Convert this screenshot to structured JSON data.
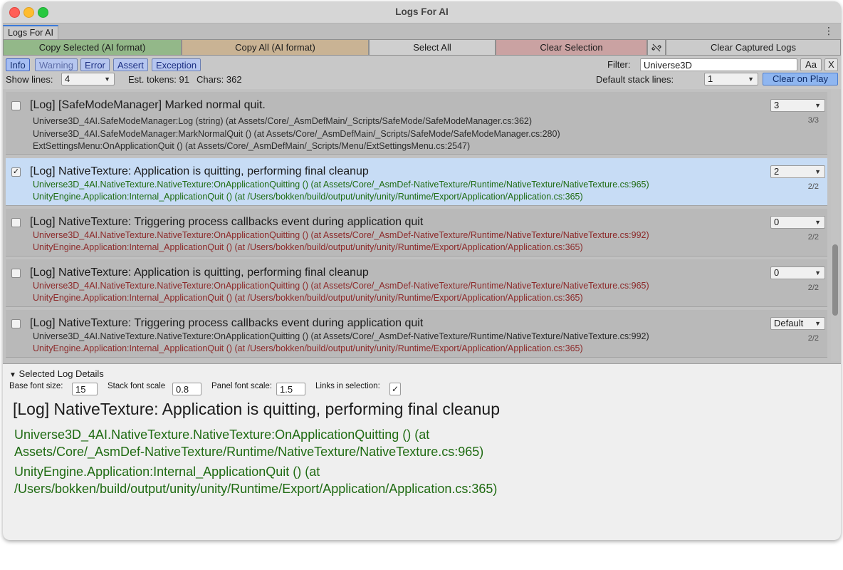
{
  "window": {
    "title": "Logs For AI"
  },
  "tabs": [
    {
      "label": "Logs For AI"
    }
  ],
  "toolbar": {
    "copy_selected": "Copy Selected (AI format)",
    "copy_all": "Copy All (AI format)",
    "select_all": "Select All",
    "clear_selection": "Clear Selection",
    "clear_captured": "Clear Captured Logs",
    "link_icon": "link-off-icon",
    "colors": {
      "copy_selected": "#93b889",
      "copy_all": "#c9b394",
      "select_all": "#cfcfcf",
      "clear_selection": "#caa2a2",
      "clear_captured": "#cbcbcb"
    }
  },
  "levels": [
    "Info",
    "Warning",
    "Error",
    "Assert",
    "Exception"
  ],
  "filter": {
    "label": "Filter:",
    "value": "Universe3D",
    "case_label": "Aa",
    "clear_label": "X"
  },
  "options": {
    "show_lines_label": "Show lines:",
    "show_lines_value": "4",
    "est_tokens": "Est. tokens: 91",
    "chars": "Chars: 362",
    "default_stack_label": "Default stack lines:",
    "default_stack_value": "1",
    "clear_on_play": "Clear on Play"
  },
  "entries": [
    {
      "checked": "",
      "message": "[Log] [SafeModeManager] Marked normal quit.",
      "lines_value": "3",
      "count": "3/3",
      "stack": [
        "Universe3D_4AI.SafeModeManager:Log (string) (at Assets/Core/_AsmDefMain/_Scripts/SafeMode/SafeModeManager.cs:362)",
        "Universe3D_4AI.SafeModeManager:MarkNormalQuit () (at Assets/Core/_AsmDefMain/_Scripts/SafeMode/SafeModeManager.cs:280)",
        "ExtSettingsMenu:OnApplicationQuit () (at Assets/Core/_AsmDefMain/_Scripts/Menu/ExtSettingsMenu.cs:2547)"
      ]
    },
    {
      "checked": "✓",
      "message": "[Log] NativeTexture: Application is quitting, performing final cleanup",
      "lines_value": "2",
      "count": "2/2",
      "stack": [
        "Universe3D_4AI.NativeTexture.NativeTexture:OnApplicationQuitting () (at Assets/Core/_AsmDef-NativeTexture/Runtime/NativeTexture/NativeTexture.cs:965)",
        "UnityEngine.Application:Internal_ApplicationQuit () (at /Users/bokken/build/output/unity/unity/Runtime/Export/Application/Application.cs:365)"
      ]
    },
    {
      "checked": "",
      "message": "[Log] NativeTexture: Triggering process callbacks event during application quit",
      "lines_value": "0",
      "count": "2/2",
      "stack": [
        "Universe3D_4AI.NativeTexture.NativeTexture:OnApplicationQuitting () (at Assets/Core/_AsmDef-NativeTexture/Runtime/NativeTexture/NativeTexture.cs:992)",
        "UnityEngine.Application:Internal_ApplicationQuit () (at /Users/bokken/build/output/unity/unity/Runtime/Export/Application/Application.cs:365)"
      ]
    },
    {
      "checked": "",
      "message": "[Log] NativeTexture: Application is quitting, performing final cleanup",
      "lines_value": "0",
      "count": "2/2",
      "stack": [
        "Universe3D_4AI.NativeTexture.NativeTexture:OnApplicationQuitting () (at Assets/Core/_AsmDef-NativeTexture/Runtime/NativeTexture/NativeTexture.cs:965)",
        "UnityEngine.Application:Internal_ApplicationQuit () (at /Users/bokken/build/output/unity/unity/Runtime/Export/Application/Application.cs:365)"
      ]
    },
    {
      "checked": "",
      "message": "[Log] NativeTexture: Triggering process callbacks event during application quit",
      "lines_value": "Default",
      "count": "2/2",
      "stack": [
        "Universe3D_4AI.NativeTexture.NativeTexture:OnApplicationQuitting () (at Assets/Core/_AsmDef-NativeTexture/Runtime/NativeTexture/NativeTexture.cs:992)",
        "UnityEngine.Application:Internal_ApplicationQuit () (at /Users/bokken/build/output/unity/unity/Runtime/Export/Application/Application.cs:365)"
      ]
    }
  ],
  "details": {
    "title": "Selected Log Details",
    "base_font_label": "Base font size:",
    "base_font_value": "15",
    "stack_scale_label": "Stack font scale",
    "stack_scale_value": "0.8",
    "panel_scale_label": "Panel font scale:",
    "panel_scale_value": "1.5",
    "links_label": "Links in selection:",
    "links_checked": "✓",
    "message": "[Log] NativeTexture: Application is quitting, performing final cleanup",
    "stack_lines": [
      "Universe3D_4AI.NativeTexture.NativeTexture:OnApplicationQuitting () (at",
      "Assets/Core/_AsmDef-NativeTexture/Runtime/NativeTexture/NativeTexture.cs:965)",
      "UnityEngine.Application:Internal_ApplicationQuit () (at",
      "/Users/bokken/build/output/unity/unity/Runtime/Export/Application/Application.cs:365)"
    ]
  }
}
